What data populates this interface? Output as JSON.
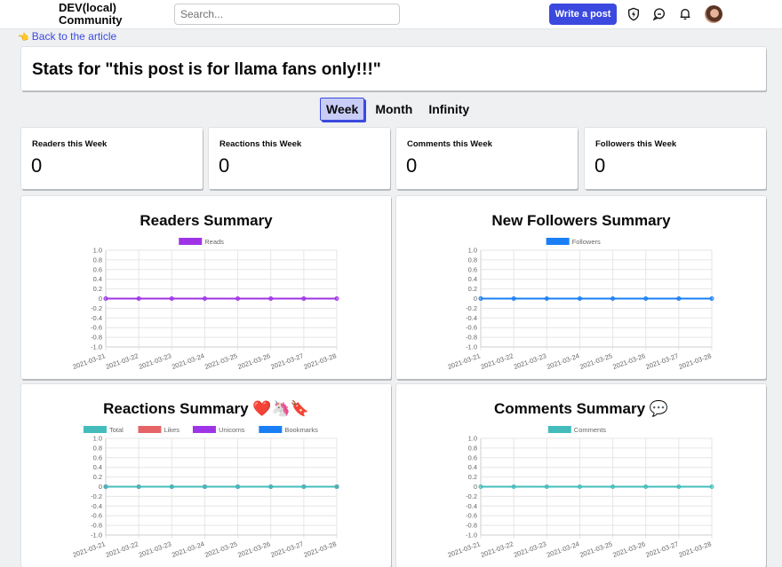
{
  "header": {
    "logo": "DEV(local)",
    "logo_line2": "Community",
    "search_placeholder": "Search...",
    "write_post_label": "Write a post",
    "icons": [
      "moderation-shield-icon",
      "chat-icon",
      "notifications-bell-icon",
      "avatar"
    ]
  },
  "back_link": {
    "icon": "👈",
    "label": "Back to the article"
  },
  "page_title": "Stats for \"this post is for llama fans only!!!\"",
  "tabs": [
    {
      "label": "Week",
      "active": true
    },
    {
      "label": "Month",
      "active": false
    },
    {
      "label": "Infinity",
      "active": false
    }
  ],
  "stats": [
    {
      "label": "Readers this Week",
      "value": "0"
    },
    {
      "label": "Reactions this Week",
      "value": "0"
    },
    {
      "label": "Comments this Week",
      "value": "0"
    },
    {
      "label": "Followers this Week",
      "value": "0"
    }
  ],
  "charts": {
    "readers": {
      "title": "Readers Summary"
    },
    "followers": {
      "title": "New Followers Summary"
    },
    "reactions": {
      "title": "Reactions Summary ❤️🦄🔖"
    },
    "comments": {
      "title": "Comments Summary 💬"
    }
  },
  "chart_data": [
    {
      "id": "readers",
      "type": "line",
      "title": "Readers Summary",
      "x": [
        "2021-03-21",
        "2021-03-22",
        "2021-03-23",
        "2021-03-24",
        "2021-03-25",
        "2021-03-26",
        "2021-03-27",
        "2021-03-28"
      ],
      "series": [
        {
          "name": "Reads",
          "color": "#9e34e6",
          "values": [
            0,
            0,
            0,
            0,
            0,
            0,
            0,
            0
          ]
        }
      ],
      "ylim": [
        -1.0,
        1.0
      ],
      "yticks": [
        "1.0",
        "0.8",
        "0.6",
        "0.4",
        "0.2",
        "0",
        "-0.2",
        "-0.4",
        "-0.6",
        "-0.8",
        "-1.0"
      ],
      "grid": true,
      "legend": "top"
    },
    {
      "id": "followers",
      "type": "line",
      "title": "New Followers Summary",
      "x": [
        "2021-03-21",
        "2021-03-22",
        "2021-03-23",
        "2021-03-24",
        "2021-03-25",
        "2021-03-26",
        "2021-03-27",
        "2021-03-28"
      ],
      "series": [
        {
          "name": "Followers",
          "color": "#1a7ff5",
          "values": [
            0,
            0,
            0,
            0,
            0,
            0,
            0,
            0
          ]
        }
      ],
      "ylim": [
        -1.0,
        1.0
      ],
      "yticks": [
        "1.0",
        "0.8",
        "0.6",
        "0.4",
        "0.2",
        "0",
        "-0.2",
        "-0.4",
        "-0.6",
        "-0.8",
        "-1.0"
      ],
      "grid": true,
      "legend": "top"
    },
    {
      "id": "reactions",
      "type": "line",
      "title": "Reactions Summary",
      "x": [
        "2021-03-21",
        "2021-03-22",
        "2021-03-23",
        "2021-03-24",
        "2021-03-25",
        "2021-03-26",
        "2021-03-27",
        "2021-03-28"
      ],
      "series": [
        {
          "name": "Bookmarks",
          "color": "#1a7ff5",
          "values": [
            0,
            0,
            0,
            0,
            0,
            0,
            0,
            0
          ]
        },
        {
          "name": "Unicorns",
          "color": "#9e34e6",
          "values": [
            0,
            0,
            0,
            0,
            0,
            0,
            0,
            0
          ]
        },
        {
          "name": "Likes",
          "color": "#e66465",
          "values": [
            0,
            0,
            0,
            0,
            0,
            0,
            0,
            0
          ]
        },
        {
          "name": "Total",
          "color": "#44bcbc",
          "values": [
            0,
            0,
            0,
            0,
            0,
            0,
            0,
            0
          ]
        }
      ],
      "legend_order": [
        "Total",
        "Likes",
        "Unicorns",
        "Bookmarks"
      ],
      "ylim": [
        -1.0,
        1.0
      ],
      "yticks": [
        "1.0",
        "0.8",
        "0.6",
        "0.4",
        "0.2",
        "0",
        "-0.2",
        "-0.4",
        "-0.6",
        "-0.8",
        "-1.0"
      ],
      "grid": true,
      "legend": "top"
    },
    {
      "id": "comments",
      "type": "line",
      "title": "Comments Summary",
      "x": [
        "2021-03-21",
        "2021-03-22",
        "2021-03-23",
        "2021-03-24",
        "2021-03-25",
        "2021-03-26",
        "2021-03-27",
        "2021-03-28"
      ],
      "series": [
        {
          "name": "Comments",
          "color": "#44bcbc",
          "values": [
            0,
            0,
            0,
            0,
            0,
            0,
            0,
            0
          ]
        }
      ],
      "ylim": [
        -1.0,
        1.0
      ],
      "yticks": [
        "1.0",
        "0.8",
        "0.6",
        "0.4",
        "0.2",
        "0",
        "-0.2",
        "-0.4",
        "-0.6",
        "-0.8",
        "-1.0"
      ],
      "grid": true,
      "legend": "top"
    }
  ]
}
